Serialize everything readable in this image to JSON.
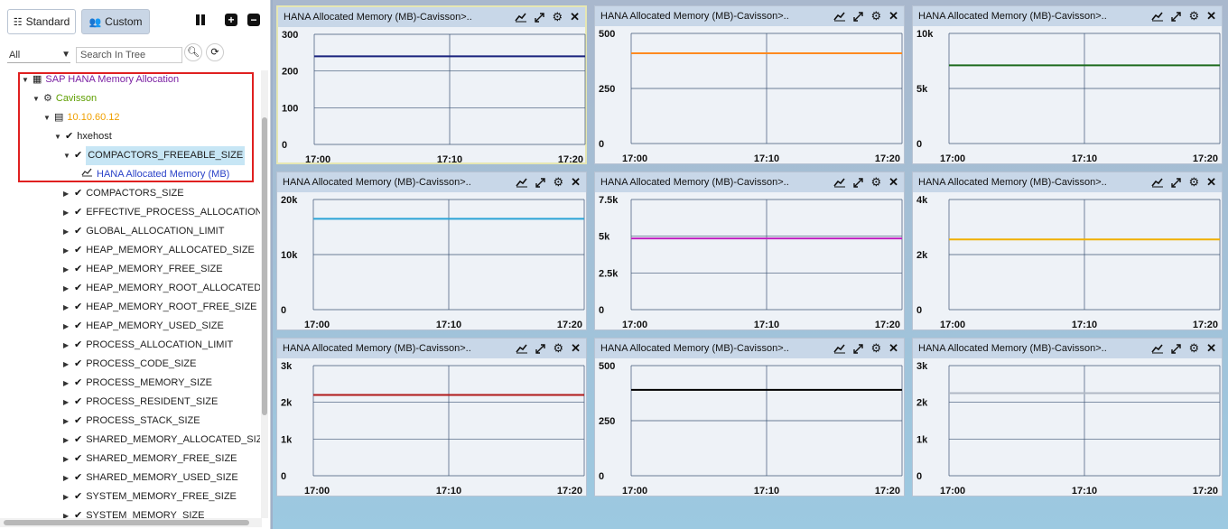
{
  "tabs": {
    "standard": "Standard",
    "custom": "Custom"
  },
  "filter": {
    "selected": "All",
    "search_placeholder": "Search In Tree"
  },
  "tree": [
    {
      "label": "SAP HANA Memory Allocation",
      "color": "#7a1fa2",
      "indent": 0,
      "icon": "grid"
    },
    {
      "label": "Cavisson",
      "color": "#5e9e00",
      "indent": 1,
      "icon": "gears"
    },
    {
      "label": "10.10.60.12",
      "color": "#f0a000",
      "indent": 2,
      "icon": "server"
    },
    {
      "label": "hxehost",
      "color": "#222222",
      "indent": 3,
      "icon": "check"
    },
    {
      "label": "COMPACTORS_FREEABLE_SIZE",
      "color": "#222222",
      "indent": 4,
      "icon": "check",
      "selected": true
    },
    {
      "label": "HANA Allocated Memory (MB)",
      "color": "#2a42c8",
      "indent": 5,
      "icon": "linechart",
      "leaf": true
    },
    {
      "label": "COMPACTORS_SIZE",
      "color": "#222222",
      "indent": 4,
      "icon": "check"
    },
    {
      "label": "EFFECTIVE_PROCESS_ALLOCATION_LIMIT",
      "color": "#222222",
      "indent": 4,
      "icon": "check"
    },
    {
      "label": "GLOBAL_ALLOCATION_LIMIT",
      "color": "#222222",
      "indent": 4,
      "icon": "check"
    },
    {
      "label": "HEAP_MEMORY_ALLOCATED_SIZE",
      "color": "#222222",
      "indent": 4,
      "icon": "check"
    },
    {
      "label": "HEAP_MEMORY_FREE_SIZE",
      "color": "#222222",
      "indent": 4,
      "icon": "check"
    },
    {
      "label": "HEAP_MEMORY_ROOT_ALLOCATED_SIZE",
      "color": "#222222",
      "indent": 4,
      "icon": "check"
    },
    {
      "label": "HEAP_MEMORY_ROOT_FREE_SIZE",
      "color": "#222222",
      "indent": 4,
      "icon": "check"
    },
    {
      "label": "HEAP_MEMORY_USED_SIZE",
      "color": "#222222",
      "indent": 4,
      "icon": "check"
    },
    {
      "label": "PROCESS_ALLOCATION_LIMIT",
      "color": "#222222",
      "indent": 4,
      "icon": "check"
    },
    {
      "label": "PROCESS_CODE_SIZE",
      "color": "#222222",
      "indent": 4,
      "icon": "check"
    },
    {
      "label": "PROCESS_MEMORY_SIZE",
      "color": "#222222",
      "indent": 4,
      "icon": "check"
    },
    {
      "label": "PROCESS_RESIDENT_SIZE",
      "color": "#222222",
      "indent": 4,
      "icon": "check"
    },
    {
      "label": "PROCESS_STACK_SIZE",
      "color": "#222222",
      "indent": 4,
      "icon": "check"
    },
    {
      "label": "SHARED_MEMORY_ALLOCATED_SIZE",
      "color": "#222222",
      "indent": 4,
      "icon": "check"
    },
    {
      "label": "SHARED_MEMORY_FREE_SIZE",
      "color": "#222222",
      "indent": 4,
      "icon": "check"
    },
    {
      "label": "SHARED_MEMORY_USED_SIZE",
      "color": "#222222",
      "indent": 4,
      "icon": "check"
    },
    {
      "label": "SYSTEM_MEMORY_FREE_SIZE",
      "color": "#222222",
      "indent": 4,
      "icon": "check"
    },
    {
      "label": "SYSTEM_MEMORY_SIZE",
      "color": "#222222",
      "indent": 4,
      "icon": "check"
    }
  ],
  "chart_data": [
    {
      "type": "line",
      "title": "HANA Allocated Memory (MB)-Cavisson>..",
      "x": [
        "17:00",
        "17:10",
        "17:20"
      ],
      "yticks": [
        "0",
        "100",
        "200",
        "300"
      ],
      "ylim": [
        0,
        300
      ],
      "series": [
        {
          "values": [
            240,
            240,
            240
          ],
          "color": "#1a237e"
        }
      ]
    },
    {
      "type": "line",
      "title": "HANA Allocated Memory (MB)-Cavisson>..",
      "x": [
        "17:00",
        "17:10",
        "17:20"
      ],
      "yticks": [
        "0",
        "250",
        "500"
      ],
      "ylim": [
        0,
        500
      ],
      "series": [
        {
          "values": [
            410,
            410,
            410
          ],
          "color": "#ff8a1f"
        }
      ]
    },
    {
      "type": "line",
      "title": "HANA Allocated Memory (MB)-Cavisson>..",
      "x": [
        "17:00",
        "17:10",
        "17:20"
      ],
      "yticks": [
        "0",
        "5k",
        "10k"
      ],
      "ylim": [
        0,
        10000
      ],
      "series": [
        {
          "values": [
            7100,
            7100,
            7100
          ],
          "color": "#1e6b1e"
        }
      ]
    },
    {
      "type": "line",
      "title": "HANA Allocated Memory (MB)-Cavisson>..",
      "x": [
        "17:00",
        "17:10",
        "17:20"
      ],
      "yticks": [
        "0",
        "10k",
        "20k"
      ],
      "ylim": [
        0,
        20000
      ],
      "series": [
        {
          "values": [
            16500,
            16500,
            16500
          ],
          "color": "#2aa3d6"
        }
      ]
    },
    {
      "type": "line",
      "title": "HANA Allocated Memory (MB)-Cavisson>..",
      "x": [
        "17:00",
        "17:10",
        "17:20"
      ],
      "yticks": [
        "0",
        "2.5k",
        "5k",
        "7.5k"
      ],
      "ylim": [
        0,
        7500
      ],
      "series": [
        {
          "values": [
            4850,
            4850,
            4850
          ],
          "color": "#c020c0"
        }
      ]
    },
    {
      "type": "line",
      "title": "HANA Allocated Memory (MB)-Cavisson>..",
      "x": [
        "17:00",
        "17:10",
        "17:20"
      ],
      "yticks": [
        "0",
        "2k",
        "4k"
      ],
      "ylim": [
        0,
        4000
      ],
      "series": [
        {
          "values": [
            2550,
            2550,
            2550
          ],
          "color": "#f0b000"
        }
      ]
    },
    {
      "type": "line",
      "title": "HANA Allocated Memory (MB)-Cavisson>..",
      "x": [
        "17:00",
        "17:10",
        "17:20"
      ],
      "yticks": [
        "0",
        "1k",
        "2k",
        "3k"
      ],
      "ylim": [
        0,
        3000
      ],
      "series": [
        {
          "values": [
            2200,
            2200,
            2200
          ],
          "color": "#b01818"
        }
      ]
    },
    {
      "type": "line",
      "title": "HANA Allocated Memory (MB)-Cavisson>..",
      "x": [
        "17:00",
        "17:10",
        "17:20"
      ],
      "yticks": [
        "0",
        "250",
        "500"
      ],
      "ylim": [
        0,
        500
      ],
      "series": [
        {
          "values": [
            390,
            390,
            390
          ],
          "color": "#000000"
        }
      ]
    },
    {
      "type": "line",
      "title": "HANA Allocated Memory (MB)-Cavisson>..",
      "x": [
        "17:00",
        "17:10",
        "17:20"
      ],
      "yticks": [
        "0",
        "1k",
        "2k",
        "3k"
      ],
      "ylim": [
        0,
        3000
      ],
      "series": [
        {
          "values": [
            2250,
            2250,
            2250
          ],
          "color": "#b0b8c4"
        }
      ]
    }
  ]
}
